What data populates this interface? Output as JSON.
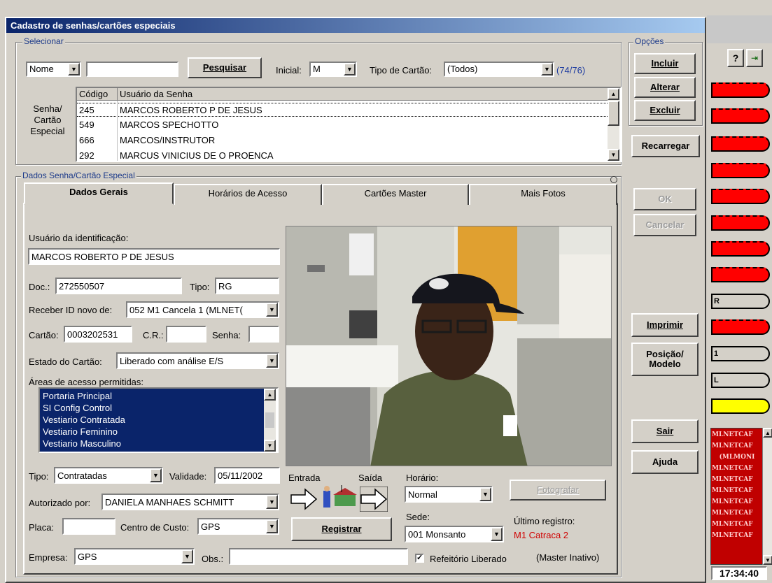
{
  "window": {
    "title": "Cadastro de senhas/cartões especiais"
  },
  "select_group": {
    "title": "Selecionar",
    "search_field": "Nome",
    "search_value": "",
    "search_button": "Pesquisar",
    "inicial_label": "Inicial:",
    "inicial_value": "M",
    "tipo_cartao_label": "Tipo de Cartão:",
    "tipo_cartao_value": "(Todos)",
    "count": "(74/76)",
    "list_label": "Senha/ Cartão Especial",
    "columns": [
      "Código",
      "Usuário da Senha"
    ],
    "rows": [
      {
        "code": "245",
        "name": "MARCOS ROBERTO P DE JESUS"
      },
      {
        "code": "549",
        "name": "MARCOS SPECHOTTO"
      },
      {
        "code": "666",
        "name": "MARCOS/INSTRUTOR"
      },
      {
        "code": "292",
        "name": "MARCUS VINICIUS DE O PROENCA"
      }
    ]
  },
  "options": {
    "title": "Opções",
    "incluir": "Incluir",
    "alterar": "Alterar",
    "excluir": "Excluir",
    "recarregar": "Recarregar",
    "ok": "OK",
    "cancelar": "Cancelar",
    "imprimir": "Imprimir",
    "posicao": "Posição/ Modelo",
    "sair": "Sair",
    "ajuda": "Ajuda"
  },
  "details": {
    "title": "Dados Senha/Cartão Especial",
    "tabs": [
      "Dados Gerais",
      "Horários de Acesso",
      "Cartões Master",
      "Mais Fotos"
    ],
    "usuario_label": "Usuário da identificação:",
    "usuario_value": "MARCOS ROBERTO P DE JESUS",
    "doc_label": "Doc.:",
    "doc_value": "272550507",
    "tipo_doc_label": "Tipo:",
    "tipo_doc_value": "RG",
    "receber_label": "Receber ID novo de:",
    "receber_value": "052 M1 Cancela 1 (MLNET(",
    "cartao_label": "Cartão:",
    "cartao_value": "0003202531",
    "cr_label": "C.R.:",
    "cr_value": "",
    "senha_label": "Senha:",
    "senha_value": "",
    "estado_label": "Estado do Cartão:",
    "estado_value": "Liberado com análise E/S",
    "areas_label": "Áreas de acesso permitidas:",
    "areas": [
      "Portaria Principal",
      "SI Config Control",
      "Vestiario Contratada",
      "Vestiario Feminino",
      "Vestiario Masculino"
    ],
    "tipo_label": "Tipo:",
    "tipo_value": "Contratadas",
    "validade_label": "Validade:",
    "validade_value": "05/11/2002",
    "autorizado_label": "Autorizado por:",
    "autorizado_value": "DANIELA MANHAES SCHMITT",
    "placa_label": "Placa:",
    "placa_value": "",
    "centro_label": "Centro de Custo:",
    "centro_value": "GPS",
    "empresa_label": "Empresa:",
    "empresa_value": "GPS",
    "obs_label": "Obs.:",
    "obs_value": "",
    "entrada_label": "Entrada",
    "saida_label": "Saída",
    "registrar": "Registrar",
    "horario_label": "Horário:",
    "horario_value": "Normal",
    "sede_label": "Sede:",
    "sede_value": "001 Monsanto",
    "fotografar": "Fotografar",
    "ultimo_label": "Último registro:",
    "ultimo_value": "M1 Catraca 2",
    "refeitorio_label": "Refeitório Liberado",
    "master_status": "(Master Inativo)"
  },
  "background": {
    "bar_labels": [
      "R",
      "1",
      "L"
    ],
    "log_lines": [
      "MLNETCAF",
      "MLNETCAF",
      "(MLMONI",
      "MLNETCAF",
      "MLNETCAF",
      "MLNETCAF",
      "MLNETCAF",
      "MLNETCAF",
      "MLNETCAF",
      "MLNETCAF"
    ],
    "clock": "17:34:40"
  }
}
